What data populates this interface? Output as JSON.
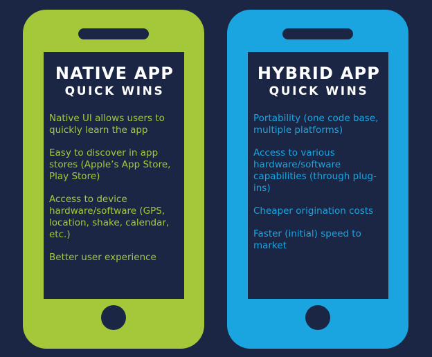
{
  "colors": {
    "background": "#1b2645",
    "native": "#a5c83a",
    "hybrid": "#1aa5e0",
    "title": "#ffffff"
  },
  "native": {
    "title": "NATIVE APP",
    "subtitle": "QUICK WINS",
    "items": [
      {
        "text": "Native UI allows users to quickly learn the app"
      },
      {
        "text": "Easy to discover in app stores (Apple’s App Store, Play Store)"
      },
      {
        "text": "Access to device hardware/software (GPS, location, shake, calendar, etc.)"
      },
      {
        "text": "Better user experience"
      }
    ]
  },
  "hybrid": {
    "title": "HYBRID APP",
    "subtitle": "QUICK WINS",
    "items": [
      {
        "text": "Portability (one code base, multiple platforms)"
      },
      {
        "text": "Access to various hardware/software capabilities (through plug-ins)"
      },
      {
        "text": "Cheaper origination costs"
      },
      {
        "text": "Faster (initial) speed to market"
      }
    ]
  }
}
